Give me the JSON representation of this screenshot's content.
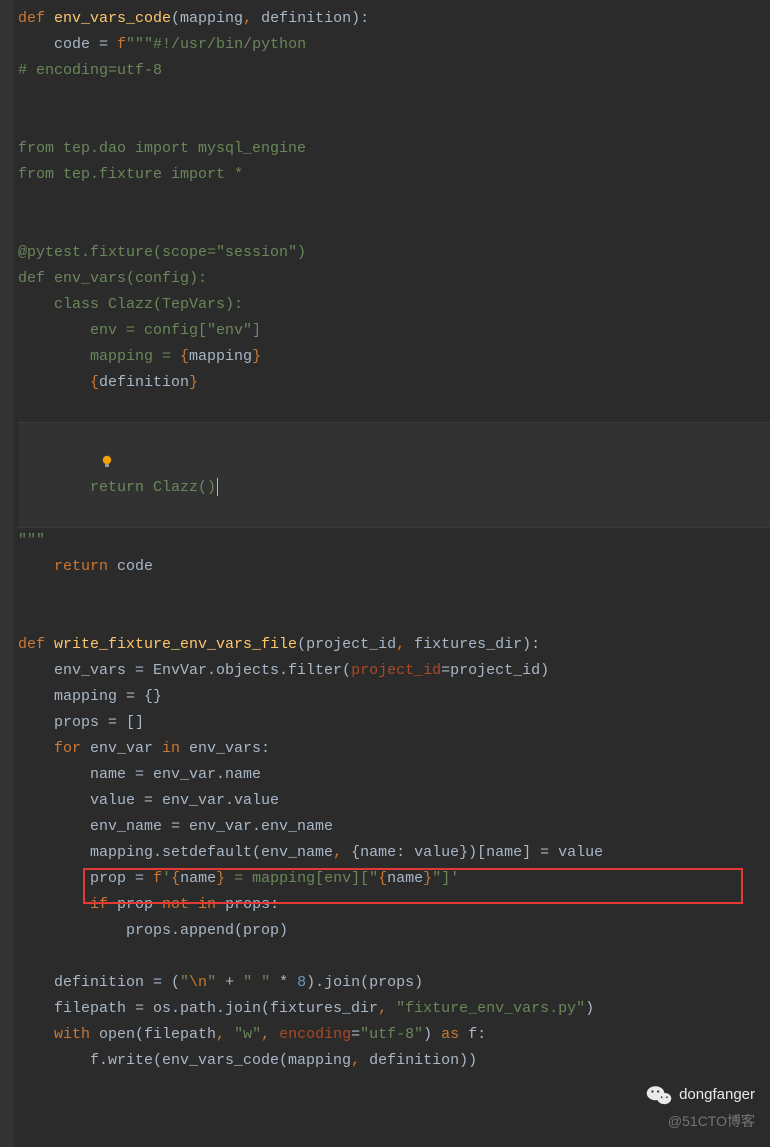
{
  "code": {
    "l1": {
      "kw1": "def ",
      "fn": "env_vars_code",
      "p": "(mapping",
      "c1": ", ",
      "p2": "definition):"
    },
    "l2": {
      "indent": "    code = ",
      "pfx": "f",
      "str": "\"\"\"#!/usr/bin/python"
    },
    "l3": "# encoding=utf-8",
    "l7": "from tep.dao import mysql_engine",
    "l8": "from tep.fixture import *",
    "l11": "@pytest.fixture(scope=\"session\")",
    "l12": "def env_vars(config):",
    "l13": "    class Clazz(TepVars):",
    "l14": "        env = config[\"env\"]",
    "l15": {
      "pre": "        mapping = ",
      "lb": "{",
      "var": "mapping",
      "rb": "}"
    },
    "l16": {
      "pre": "        ",
      "lb": "{",
      "var": "definition",
      "rb": "}"
    },
    "l18": "    return Clazz()",
    "l19": "\"\"\"",
    "l20": {
      "kw": "    return ",
      "id": "code"
    },
    "l23": {
      "kw": "def ",
      "fn": "write_fixture_env_vars_file",
      "rest": "(project_id",
      "c": ", ",
      "rest2": "fixtures_dir):"
    },
    "l24": {
      "pre": "    env_vars = EnvVar.objects.filter(",
      "named": "project_id",
      "post": "=project_id)"
    },
    "l25": "    mapping = {}",
    "l26": "    props = []",
    "l27": {
      "kw1": "    for ",
      "id1": "env_var ",
      "kw2": "in ",
      "id2": "env_vars:"
    },
    "l28": "        name = env_var.name",
    "l29": "        value = env_var.value",
    "l30": "        env_name = env_var.env_name",
    "l31": {
      "pre": "        mapping.setdefault(env_name",
      "c": ", ",
      "post": "{name: value})[name] = value"
    },
    "l32": {
      "pre": "        prop = ",
      "pfx": "f",
      "q": "'",
      "lb1": "{",
      "v1": "name",
      "rb1": "}",
      "mid": " = mapping[env][\"",
      "lb2": "{",
      "v2": "name",
      "rb2": "}",
      "end": "\"]'"
    },
    "l33": {
      "kw1": "        if ",
      "id1": "prop ",
      "kw2": "not in ",
      "id2": "props:"
    },
    "l34": "            props.append(prop)",
    "l36": {
      "pre": "    definition = (",
      "s1": "\"",
      "esc": "\\n",
      "s1b": "\" ",
      "plus": "+ ",
      "s2": "\" \" ",
      "star": "* ",
      "num": "8",
      "post": ").join(props)"
    },
    "l37": {
      "pre": "    filepath = os.path.join(fixtures_dir",
      "c": ", ",
      "str": "\"fixture_env_vars.py\"",
      "post": ")"
    },
    "l38": {
      "kw1": "    with ",
      "call": "open(filepath",
      "c1": ", ",
      "s1": "\"w\"",
      "c2": ", ",
      "named": "encoding",
      "eq": "=",
      "s2": "\"utf-8\"",
      "post": ") ",
      "kw2": "as ",
      "id": "f:"
    },
    "l39": {
      "pre": "        f.write(env_vars_code(mapping",
      "c": ", ",
      "post": "definition))"
    }
  },
  "watermark": {
    "wechat": "dongfanger",
    "cto": "@51CTO博客"
  }
}
